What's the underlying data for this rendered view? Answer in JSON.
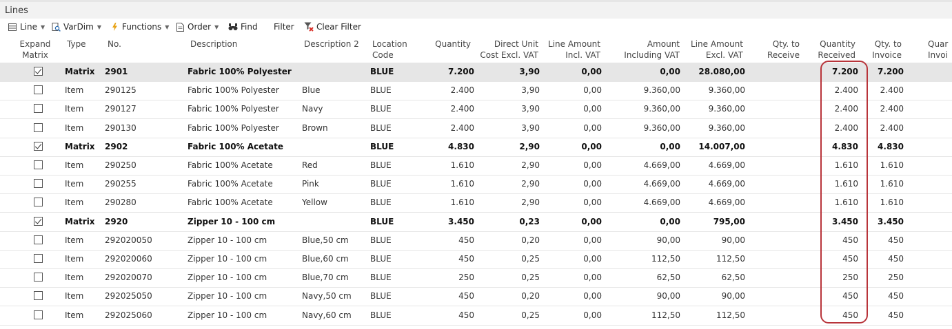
{
  "panel": {
    "title": "Lines"
  },
  "toolbar": {
    "line": "Line",
    "vardim": "VarDim",
    "functions": "Functions",
    "order": "Order",
    "find": "Find",
    "filter": "Filter",
    "clear_filter": "Clear Filter"
  },
  "colors": {
    "highlight": "#b8343a",
    "selected_row": "#e6e6e6"
  },
  "headers": {
    "expand": [
      "Expand",
      "Matrix"
    ],
    "type": "Type",
    "no": "No.",
    "description": "Description",
    "description2": "Description 2",
    "location": [
      "Location",
      "Code"
    ],
    "quantity": "Quantity",
    "unit_cost": [
      "Direct Unit",
      "Cost Excl. VAT"
    ],
    "line_incl": [
      "Line Amount",
      "Incl. VAT"
    ],
    "amount_incl": [
      "Amount",
      "Including VAT"
    ],
    "line_excl": [
      "Line Amount",
      "Excl. VAT"
    ],
    "qty_receive": [
      "Qty. to",
      "Receive"
    ],
    "qty_received": [
      "Quantity",
      "Received"
    ],
    "qty_invoice": [
      "Qty. to",
      "Invoice"
    ],
    "qty_invoiced": [
      "Quar",
      "Invoi"
    ]
  },
  "rows": [
    {
      "checked": true,
      "bold": true,
      "selected": true,
      "type": "Matrix",
      "no": "2901",
      "description": "Fabric 100% Polyester",
      "description2": "",
      "location": "BLUE",
      "quantity": "7.200",
      "unit_cost": "3,90",
      "line_incl": "0,00",
      "amount_incl": "0,00",
      "line_excl": "28.080,00",
      "qty_receive": "",
      "qty_received": "7.200",
      "qty_invoice": "7.200"
    },
    {
      "checked": false,
      "bold": false,
      "selected": false,
      "type": "Item",
      "no": "290125",
      "description": "Fabric 100% Polyester",
      "description2": "Blue",
      "location": "BLUE",
      "quantity": "2.400",
      "unit_cost": "3,90",
      "line_incl": "0,00",
      "amount_incl": "9.360,00",
      "line_excl": "9.360,00",
      "qty_receive": "",
      "qty_received": "2.400",
      "qty_invoice": "2.400"
    },
    {
      "checked": false,
      "bold": false,
      "selected": false,
      "type": "Item",
      "no": "290127",
      "description": "Fabric 100% Polyester",
      "description2": "Navy",
      "location": "BLUE",
      "quantity": "2.400",
      "unit_cost": "3,90",
      "line_incl": "0,00",
      "amount_incl": "9.360,00",
      "line_excl": "9.360,00",
      "qty_receive": "",
      "qty_received": "2.400",
      "qty_invoice": "2.400"
    },
    {
      "checked": false,
      "bold": false,
      "selected": false,
      "type": "Item",
      "no": "290130",
      "description": "Fabric 100% Polyester",
      "description2": "Brown",
      "location": "BLUE",
      "quantity": "2.400",
      "unit_cost": "3,90",
      "line_incl": "0,00",
      "amount_incl": "9.360,00",
      "line_excl": "9.360,00",
      "qty_receive": "",
      "qty_received": "2.400",
      "qty_invoice": "2.400"
    },
    {
      "checked": true,
      "bold": true,
      "selected": false,
      "type": "Matrix",
      "no": "2902",
      "description": "Fabric 100% Acetate",
      "description2": "",
      "location": "BLUE",
      "quantity": "4.830",
      "unit_cost": "2,90",
      "line_incl": "0,00",
      "amount_incl": "0,00",
      "line_excl": "14.007,00",
      "qty_receive": "",
      "qty_received": "4.830",
      "qty_invoice": "4.830"
    },
    {
      "checked": false,
      "bold": false,
      "selected": false,
      "type": "Item",
      "no": "290250",
      "description": "Fabric 100% Acetate",
      "description2": "Red",
      "location": "BLUE",
      "quantity": "1.610",
      "unit_cost": "2,90",
      "line_incl": "0,00",
      "amount_incl": "4.669,00",
      "line_excl": "4.669,00",
      "qty_receive": "",
      "qty_received": "1.610",
      "qty_invoice": "1.610"
    },
    {
      "checked": false,
      "bold": false,
      "selected": false,
      "type": "Item",
      "no": "290255",
      "description": "Fabric 100% Acetate",
      "description2": "Pink",
      "location": "BLUE",
      "quantity": "1.610",
      "unit_cost": "2,90",
      "line_incl": "0,00",
      "amount_incl": "4.669,00",
      "line_excl": "4.669,00",
      "qty_receive": "",
      "qty_received": "1.610",
      "qty_invoice": "1.610"
    },
    {
      "checked": false,
      "bold": false,
      "selected": false,
      "type": "Item",
      "no": "290280",
      "description": "Fabric 100% Acetate",
      "description2": "Yellow",
      "location": "BLUE",
      "quantity": "1.610",
      "unit_cost": "2,90",
      "line_incl": "0,00",
      "amount_incl": "4.669,00",
      "line_excl": "4.669,00",
      "qty_receive": "",
      "qty_received": "1.610",
      "qty_invoice": "1.610"
    },
    {
      "checked": true,
      "bold": true,
      "selected": false,
      "type": "Matrix",
      "no": "2920",
      "description": "Zipper 10 - 100 cm",
      "description2": "",
      "location": "BLUE",
      "quantity": "3.450",
      "unit_cost": "0,23",
      "line_incl": "0,00",
      "amount_incl": "0,00",
      "line_excl": "795,00",
      "qty_receive": "",
      "qty_received": "3.450",
      "qty_invoice": "3.450"
    },
    {
      "checked": false,
      "bold": false,
      "selected": false,
      "type": "Item",
      "no": "292020050",
      "description": "Zipper 10 - 100 cm",
      "description2": "Blue,50 cm",
      "location": "BLUE",
      "quantity": "450",
      "unit_cost": "0,20",
      "line_incl": "0,00",
      "amount_incl": "90,00",
      "line_excl": "90,00",
      "qty_receive": "",
      "qty_received": "450",
      "qty_invoice": "450"
    },
    {
      "checked": false,
      "bold": false,
      "selected": false,
      "type": "Item",
      "no": "292020060",
      "description": "Zipper 10 - 100 cm",
      "description2": "Blue,60 cm",
      "location": "BLUE",
      "quantity": "450",
      "unit_cost": "0,25",
      "line_incl": "0,00",
      "amount_incl": "112,50",
      "line_excl": "112,50",
      "qty_receive": "",
      "qty_received": "450",
      "qty_invoice": "450"
    },
    {
      "checked": false,
      "bold": false,
      "selected": false,
      "type": "Item",
      "no": "292020070",
      "description": "Zipper 10 - 100 cm",
      "description2": "Blue,70 cm",
      "location": "BLUE",
      "quantity": "250",
      "unit_cost": "0,25",
      "line_incl": "0,00",
      "amount_incl": "62,50",
      "line_excl": "62,50",
      "qty_receive": "",
      "qty_received": "250",
      "qty_invoice": "250"
    },
    {
      "checked": false,
      "bold": false,
      "selected": false,
      "type": "Item",
      "no": "292025050",
      "description": "Zipper 10 - 100 cm",
      "description2": "Navy,50 cm",
      "location": "BLUE",
      "quantity": "450",
      "unit_cost": "0,20",
      "line_incl": "0,00",
      "amount_incl": "90,00",
      "line_excl": "90,00",
      "qty_receive": "",
      "qty_received": "450",
      "qty_invoice": "450"
    },
    {
      "checked": false,
      "bold": false,
      "selected": false,
      "type": "Item",
      "no": "292025060",
      "description": "Zipper 10 - 100 cm",
      "description2": "Navy,60 cm",
      "location": "BLUE",
      "quantity": "450",
      "unit_cost": "0,25",
      "line_incl": "0,00",
      "amount_incl": "112,50",
      "line_excl": "112,50",
      "qty_receive": "",
      "qty_received": "450",
      "qty_invoice": "450"
    }
  ]
}
